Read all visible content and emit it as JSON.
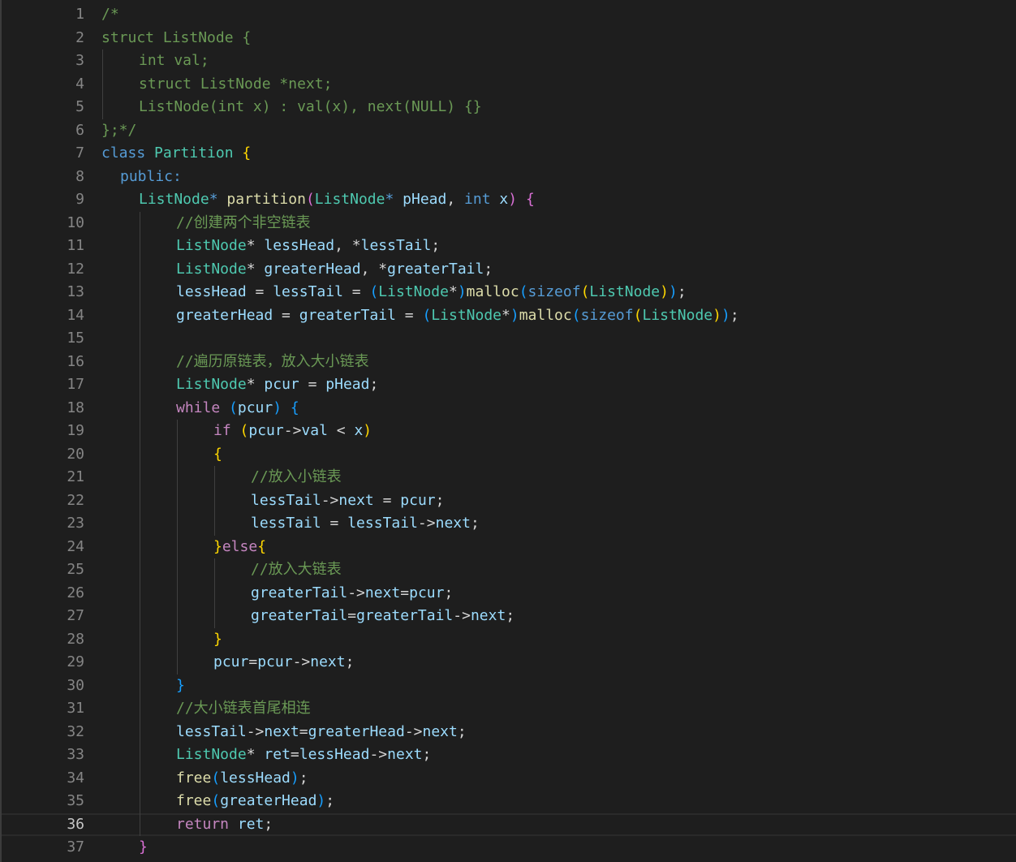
{
  "editor": {
    "language": "cpp",
    "current_line": 36,
    "colors": {
      "background": "#1e1e1e",
      "line_number": "#858585",
      "comment": "#6a9955",
      "keyword": "#569cd6",
      "control": "#c586c0",
      "type": "#4ec9b0",
      "function": "#dcdcaa",
      "variable": "#9cdcfe",
      "plain": "#d4d4d4",
      "bracket_gold": "#ffd700",
      "bracket_orchid": "#da70d6",
      "bracket_blue": "#179fff"
    },
    "lines": [
      {
        "n": "1",
        "indent": 0,
        "tokens": [
          [
            "/*",
            "comment"
          ]
        ]
      },
      {
        "n": "2",
        "indent": 0,
        "tokens": [
          [
            "struct ListNode {",
            "comment"
          ]
        ]
      },
      {
        "n": "3",
        "indent": 1,
        "tokens": [
          [
            "int val;",
            "comment"
          ]
        ]
      },
      {
        "n": "4",
        "indent": 1,
        "tokens": [
          [
            "struct ListNode *next;",
            "comment"
          ]
        ]
      },
      {
        "n": "5",
        "indent": 1,
        "tokens": [
          [
            "ListNode(int x) : val(x), next(NULL) {}",
            "comment"
          ]
        ]
      },
      {
        "n": "6",
        "indent": 0,
        "tokens": [
          [
            "};*/",
            "comment"
          ]
        ]
      },
      {
        "n": "7",
        "indent": 0,
        "tokens": [
          [
            "class",
            "keyword"
          ],
          [
            " ",
            "plain"
          ],
          [
            "Partition",
            "type"
          ],
          [
            " ",
            "plain"
          ],
          [
            "{",
            "brace1"
          ]
        ]
      },
      {
        "n": "8",
        "indent": 0.5,
        "tokens": [
          [
            "public",
            "keyword"
          ],
          [
            ":",
            "keyword"
          ]
        ]
      },
      {
        "n": "9",
        "indent": 1,
        "tokens": [
          [
            "ListNode",
            "type"
          ],
          [
            "*",
            "keyword"
          ],
          [
            " ",
            "plain"
          ],
          [
            "partition",
            "func"
          ],
          [
            "(",
            "brace2"
          ],
          [
            "ListNode",
            "type"
          ],
          [
            "*",
            "keyword"
          ],
          [
            " ",
            "plain"
          ],
          [
            "pHead",
            "var"
          ],
          [
            ", ",
            "plain"
          ],
          [
            "int",
            "keyword"
          ],
          [
            " ",
            "plain"
          ],
          [
            "x",
            "var"
          ],
          [
            ")",
            "brace2"
          ],
          [
            " ",
            "plain"
          ],
          [
            "{",
            "brace2"
          ]
        ]
      },
      {
        "n": "10",
        "indent": 2,
        "tokens": [
          [
            "//创建两个非空链表",
            "comment"
          ]
        ]
      },
      {
        "n": "11",
        "indent": 2,
        "tokens": [
          [
            "ListNode",
            "type"
          ],
          [
            "*",
            "plain"
          ],
          [
            " ",
            "plain"
          ],
          [
            "lessHead",
            "var"
          ],
          [
            ", ",
            "plain"
          ],
          [
            "*",
            "plain"
          ],
          [
            "lessTail",
            "var"
          ],
          [
            ";",
            "plain"
          ]
        ]
      },
      {
        "n": "12",
        "indent": 2,
        "tokens": [
          [
            "ListNode",
            "type"
          ],
          [
            "*",
            "plain"
          ],
          [
            " ",
            "plain"
          ],
          [
            "greaterHead",
            "var"
          ],
          [
            ", ",
            "plain"
          ],
          [
            "*",
            "plain"
          ],
          [
            "greaterTail",
            "var"
          ],
          [
            ";",
            "plain"
          ]
        ]
      },
      {
        "n": "13",
        "indent": 2,
        "tokens": [
          [
            "lessHead",
            "var"
          ],
          [
            " = ",
            "plain"
          ],
          [
            "lessTail",
            "var"
          ],
          [
            " = ",
            "plain"
          ],
          [
            "(",
            "brace3"
          ],
          [
            "ListNode",
            "type"
          ],
          [
            "*",
            "plain"
          ],
          [
            ")",
            "brace3"
          ],
          [
            "malloc",
            "func"
          ],
          [
            "(",
            "brace3"
          ],
          [
            "sizeof",
            "keyword"
          ],
          [
            "(",
            "brace1"
          ],
          [
            "ListNode",
            "type"
          ],
          [
            ")",
            "brace1"
          ],
          [
            ")",
            "brace3"
          ],
          [
            ";",
            "plain"
          ]
        ]
      },
      {
        "n": "14",
        "indent": 2,
        "tokens": [
          [
            "greaterHead",
            "var"
          ],
          [
            " = ",
            "plain"
          ],
          [
            "greaterTail",
            "var"
          ],
          [
            " = ",
            "plain"
          ],
          [
            "(",
            "brace3"
          ],
          [
            "ListNode",
            "type"
          ],
          [
            "*",
            "plain"
          ],
          [
            ")",
            "brace3"
          ],
          [
            "malloc",
            "func"
          ],
          [
            "(",
            "brace3"
          ],
          [
            "sizeof",
            "keyword"
          ],
          [
            "(",
            "brace1"
          ],
          [
            "ListNode",
            "type"
          ],
          [
            ")",
            "brace1"
          ],
          [
            ")",
            "brace3"
          ],
          [
            ";",
            "plain"
          ]
        ]
      },
      {
        "n": "15",
        "indent": 2,
        "tokens": []
      },
      {
        "n": "16",
        "indent": 2,
        "tokens": [
          [
            "//遍历原链表，放入大小链表",
            "comment"
          ]
        ]
      },
      {
        "n": "17",
        "indent": 2,
        "tokens": [
          [
            "ListNode",
            "type"
          ],
          [
            "*",
            "plain"
          ],
          [
            " ",
            "plain"
          ],
          [
            "pcur",
            "var"
          ],
          [
            " = ",
            "plain"
          ],
          [
            "pHead",
            "var"
          ],
          [
            ";",
            "plain"
          ]
        ]
      },
      {
        "n": "18",
        "indent": 2,
        "tokens": [
          [
            "while",
            "control"
          ],
          [
            " ",
            "plain"
          ],
          [
            "(",
            "brace3"
          ],
          [
            "pcur",
            "var"
          ],
          [
            ")",
            "brace3"
          ],
          [
            " ",
            "plain"
          ],
          [
            "{",
            "brace3"
          ]
        ]
      },
      {
        "n": "19",
        "indent": 3,
        "tokens": [
          [
            "if",
            "control"
          ],
          [
            " ",
            "plain"
          ],
          [
            "(",
            "brace1"
          ],
          [
            "pcur",
            "var"
          ],
          [
            "->",
            "plain"
          ],
          [
            "val",
            "var"
          ],
          [
            " < ",
            "plain"
          ],
          [
            "x",
            "var"
          ],
          [
            ")",
            "brace1"
          ]
        ]
      },
      {
        "n": "20",
        "indent": 3,
        "tokens": [
          [
            "{",
            "brace1"
          ]
        ]
      },
      {
        "n": "21",
        "indent": 4,
        "tokens": [
          [
            "//放入小链表",
            "comment"
          ]
        ]
      },
      {
        "n": "22",
        "indent": 4,
        "tokens": [
          [
            "lessTail",
            "var"
          ],
          [
            "->",
            "plain"
          ],
          [
            "next",
            "var"
          ],
          [
            " = ",
            "plain"
          ],
          [
            "pcur",
            "var"
          ],
          [
            ";",
            "plain"
          ]
        ]
      },
      {
        "n": "23",
        "indent": 4,
        "tokens": [
          [
            "lessTail",
            "var"
          ],
          [
            " = ",
            "plain"
          ],
          [
            "lessTail",
            "var"
          ],
          [
            "->",
            "plain"
          ],
          [
            "next",
            "var"
          ],
          [
            ";",
            "plain"
          ]
        ]
      },
      {
        "n": "24",
        "indent": 3,
        "tokens": [
          [
            "}",
            "brace1"
          ],
          [
            "else",
            "control"
          ],
          [
            "{",
            "brace1"
          ]
        ]
      },
      {
        "n": "25",
        "indent": 4,
        "tokens": [
          [
            "//放入大链表",
            "comment"
          ]
        ]
      },
      {
        "n": "26",
        "indent": 4,
        "tokens": [
          [
            "greaterTail",
            "var"
          ],
          [
            "->",
            "plain"
          ],
          [
            "next",
            "var"
          ],
          [
            "=",
            "plain"
          ],
          [
            "pcur",
            "var"
          ],
          [
            ";",
            "plain"
          ]
        ]
      },
      {
        "n": "27",
        "indent": 4,
        "tokens": [
          [
            "greaterTail",
            "var"
          ],
          [
            "=",
            "plain"
          ],
          [
            "greaterTail",
            "var"
          ],
          [
            "->",
            "plain"
          ],
          [
            "next",
            "var"
          ],
          [
            ";",
            "plain"
          ]
        ]
      },
      {
        "n": "28",
        "indent": 3,
        "tokens": [
          [
            "}",
            "brace1"
          ]
        ]
      },
      {
        "n": "29",
        "indent": 3,
        "tokens": [
          [
            "pcur",
            "var"
          ],
          [
            "=",
            "plain"
          ],
          [
            "pcur",
            "var"
          ],
          [
            "->",
            "plain"
          ],
          [
            "next",
            "var"
          ],
          [
            ";",
            "plain"
          ]
        ]
      },
      {
        "n": "30",
        "indent": 2,
        "tokens": [
          [
            "}",
            "brace3"
          ]
        ]
      },
      {
        "n": "31",
        "indent": 2,
        "tokens": [
          [
            "//大小链表首尾相连",
            "comment"
          ]
        ]
      },
      {
        "n": "32",
        "indent": 2,
        "tokens": [
          [
            "lessTail",
            "var"
          ],
          [
            "->",
            "plain"
          ],
          [
            "next",
            "var"
          ],
          [
            "=",
            "plain"
          ],
          [
            "greaterHead",
            "var"
          ],
          [
            "->",
            "plain"
          ],
          [
            "next",
            "var"
          ],
          [
            ";",
            "plain"
          ]
        ]
      },
      {
        "n": "33",
        "indent": 2,
        "tokens": [
          [
            "ListNode",
            "type"
          ],
          [
            "*",
            "plain"
          ],
          [
            " ",
            "plain"
          ],
          [
            "ret",
            "var"
          ],
          [
            "=",
            "plain"
          ],
          [
            "lessHead",
            "var"
          ],
          [
            "->",
            "plain"
          ],
          [
            "next",
            "var"
          ],
          [
            ";",
            "plain"
          ]
        ]
      },
      {
        "n": "34",
        "indent": 2,
        "tokens": [
          [
            "free",
            "func"
          ],
          [
            "(",
            "brace3"
          ],
          [
            "lessHead",
            "var"
          ],
          [
            ")",
            "brace3"
          ],
          [
            ";",
            "plain"
          ]
        ]
      },
      {
        "n": "35",
        "indent": 2,
        "tokens": [
          [
            "free",
            "func"
          ],
          [
            "(",
            "brace3"
          ],
          [
            "greaterHead",
            "var"
          ],
          [
            ")",
            "brace3"
          ],
          [
            ";",
            "plain"
          ]
        ]
      },
      {
        "n": "36",
        "indent": 2,
        "tokens": [
          [
            "return",
            "control"
          ],
          [
            " ",
            "plain"
          ],
          [
            "ret",
            "var"
          ],
          [
            ";",
            "plain"
          ]
        ]
      },
      {
        "n": "37",
        "indent": 1,
        "tokens": [
          [
            "}",
            "brace2"
          ]
        ]
      }
    ]
  }
}
